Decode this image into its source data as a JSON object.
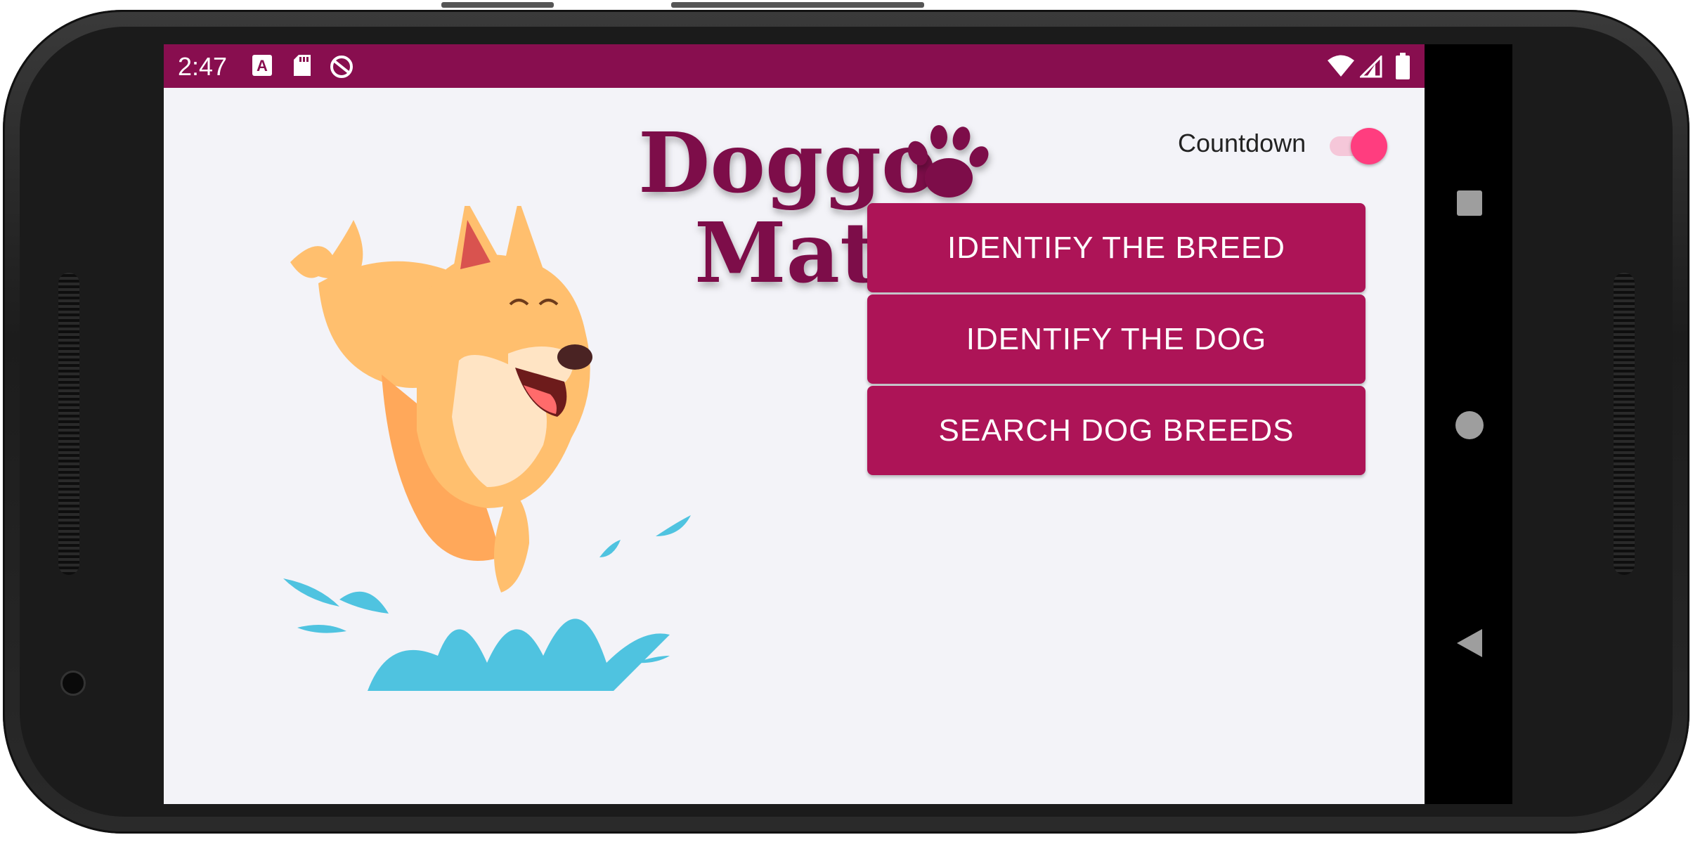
{
  "status_bar": {
    "time": "2:47",
    "left_icons": [
      "a-notification-icon",
      "sd-card-icon",
      "sync-icon"
    ],
    "right_icons": [
      "wifi-icon",
      "signal-icon",
      "battery-icon"
    ],
    "background": "#880e4f"
  },
  "app": {
    "logo_line1": "Doggo",
    "logo_line2": "Match",
    "countdown_label": "Countdown",
    "countdown_enabled": true
  },
  "menu": {
    "buttons": [
      {
        "label": "IDENTIFY THE BREED"
      },
      {
        "label": "IDENTIFY THE DOG"
      },
      {
        "label": "SEARCH DOG BREEDS"
      }
    ]
  },
  "nav_bar": {
    "icons": [
      "recents-square-icon",
      "home-circle-icon",
      "back-triangle-icon"
    ]
  },
  "colors": {
    "accent": "#ad1457",
    "status_bar": "#880e4f",
    "switch_thumb": "#ff3d7f",
    "background": "#f3f3f8"
  }
}
